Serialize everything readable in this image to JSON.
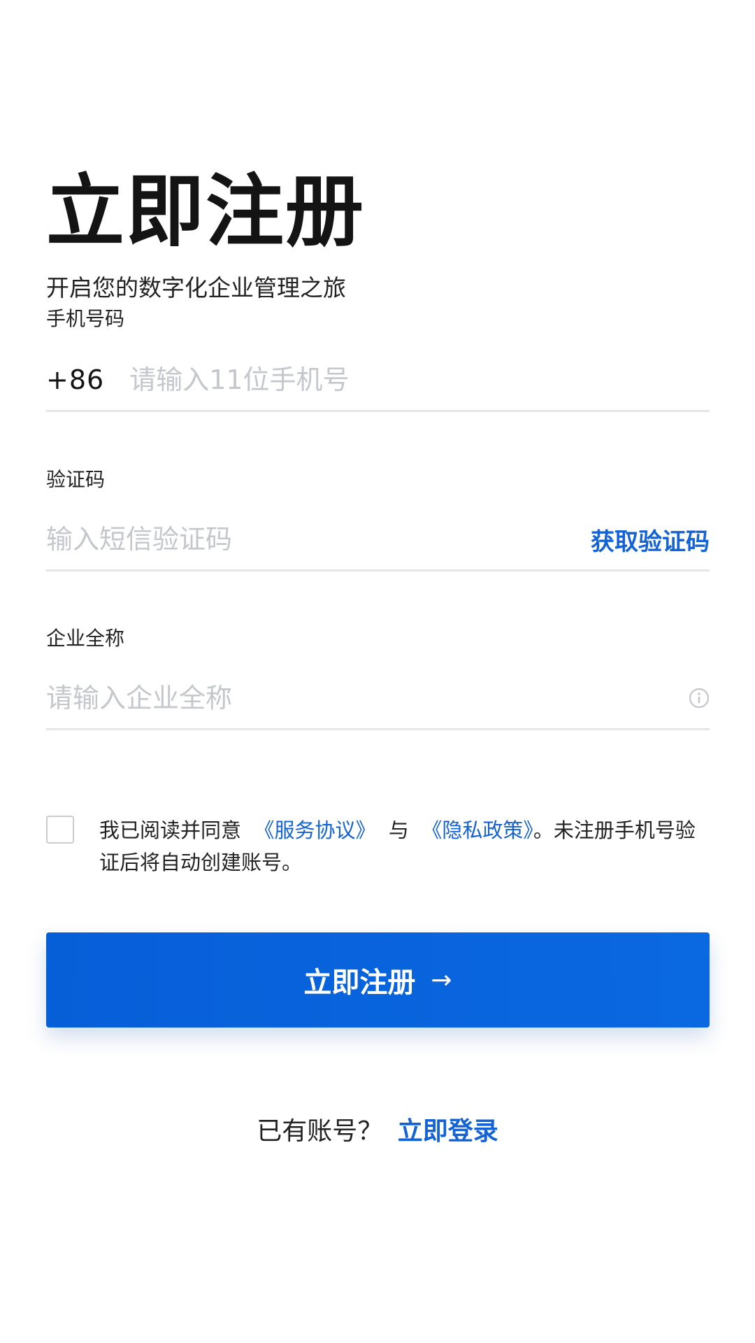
{
  "header": {
    "title": "立即注册",
    "subtitle": "开启您的数字化企业管理之旅"
  },
  "phone": {
    "label": "手机号码",
    "country_code": "+86",
    "placeholder": "请输入11位手机号",
    "value": ""
  },
  "code": {
    "label": "验证码",
    "placeholder": "输入短信验证码",
    "value": "",
    "get_code_label": "获取验证码"
  },
  "company": {
    "label": "企业全称",
    "placeholder": "请输入企业全称",
    "value": "",
    "info_icon": "info-circle-icon"
  },
  "agreement": {
    "checked": false,
    "prefix": "我已阅读并同意",
    "service_link": "《服务协议》",
    "conjunction": "与",
    "privacy_link": "《隐私政策》",
    "suffix": "。未注册手机号验证后将自动创建账号。"
  },
  "submit": {
    "label": "立即注册",
    "arrow": "→"
  },
  "footer": {
    "prompt": "已有账号？",
    "login_link": "立即登录"
  },
  "colors": {
    "accent": "#1463d6",
    "button": "#075fd8",
    "divider": "#e4e6ea",
    "placeholder": "#c4c7cc"
  }
}
